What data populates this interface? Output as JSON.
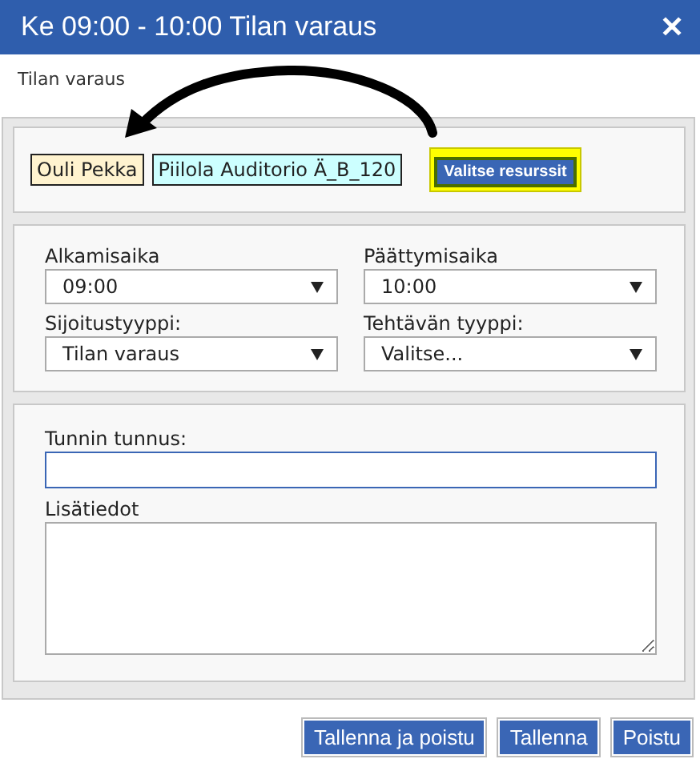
{
  "window": {
    "title": "Ke 09:00 - 10:00 Tilan varaus",
    "close": "✕"
  },
  "subtitle": "Tilan varaus",
  "resources": [
    {
      "label": "Ouli Pekka",
      "color": "#fff3cf"
    },
    {
      "label": "Piilola Auditorio Ä_B_120",
      "color": "#ccffff"
    }
  ],
  "select_resources_button": {
    "label": "Valitse resurssit",
    "highlighted": true
  },
  "selects": [
    {
      "label": "Alkamisaika",
      "value": "09:00"
    },
    {
      "label": "Päättymisaika",
      "value": "10:00"
    },
    {
      "label": "Sijoitustyyppi:",
      "value": "Tilan varaus"
    },
    {
      "label": "Tehtävän tyyppi:",
      "value": "Valitse..."
    }
  ],
  "code_field": {
    "label": "Tunnin tunnus:",
    "focused": true
  },
  "notes_field": {
    "label": "Lisätiedot"
  },
  "buttons": [
    "Tallenna ja poistu",
    "Tallenna",
    "Poistu"
  ]
}
